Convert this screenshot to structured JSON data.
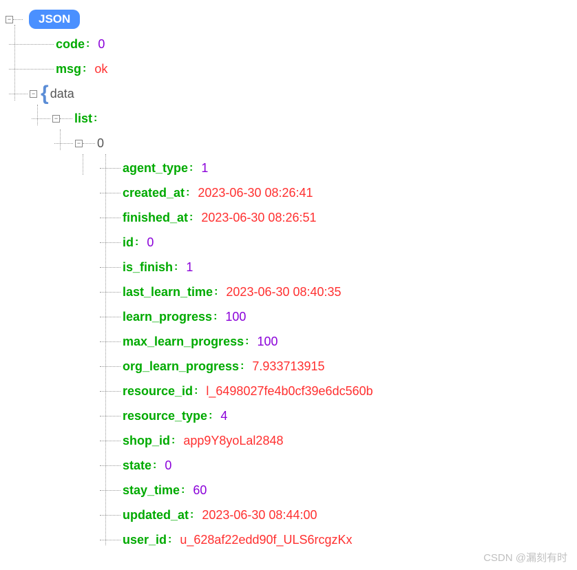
{
  "root_label": "JSON",
  "data_label": "data",
  "list_label": "list",
  "list_index": "0",
  "top": [
    {
      "key": "code",
      "val": "0",
      "type": "num"
    },
    {
      "key": "msg",
      "val": "ok",
      "type": "str"
    }
  ],
  "item": [
    {
      "key": "agent_type",
      "val": "1",
      "type": "num"
    },
    {
      "key": "created_at",
      "val": "2023-06-30 08:26:41",
      "type": "str"
    },
    {
      "key": "finished_at",
      "val": "2023-06-30 08:26:51",
      "type": "str"
    },
    {
      "key": "id",
      "val": "0",
      "type": "num"
    },
    {
      "key": "is_finish",
      "val": "1",
      "type": "num"
    },
    {
      "key": "last_learn_time",
      "val": "2023-06-30 08:40:35",
      "type": "str"
    },
    {
      "key": "learn_progress",
      "val": "100",
      "type": "num"
    },
    {
      "key": "max_learn_progress",
      "val": "100",
      "type": "num"
    },
    {
      "key": "org_learn_progress",
      "val": "7.933713915",
      "type": "str"
    },
    {
      "key": "resource_id",
      "val": "l_6498027fe4b0cf39e6dc560b",
      "type": "str"
    },
    {
      "key": "resource_type",
      "val": "4",
      "type": "num"
    },
    {
      "key": "shop_id",
      "val": "app9Y8yoLal2848",
      "type": "str"
    },
    {
      "key": "state",
      "val": "0",
      "type": "num"
    },
    {
      "key": "stay_time",
      "val": "60",
      "type": "num"
    },
    {
      "key": "updated_at",
      "val": "2023-06-30 08:44:00",
      "type": "str"
    },
    {
      "key": "user_id",
      "val": "u_628af22edd90f_ULS6rcgzKx",
      "type": "str"
    }
  ],
  "watermark": "CSDN @漏刻有时"
}
